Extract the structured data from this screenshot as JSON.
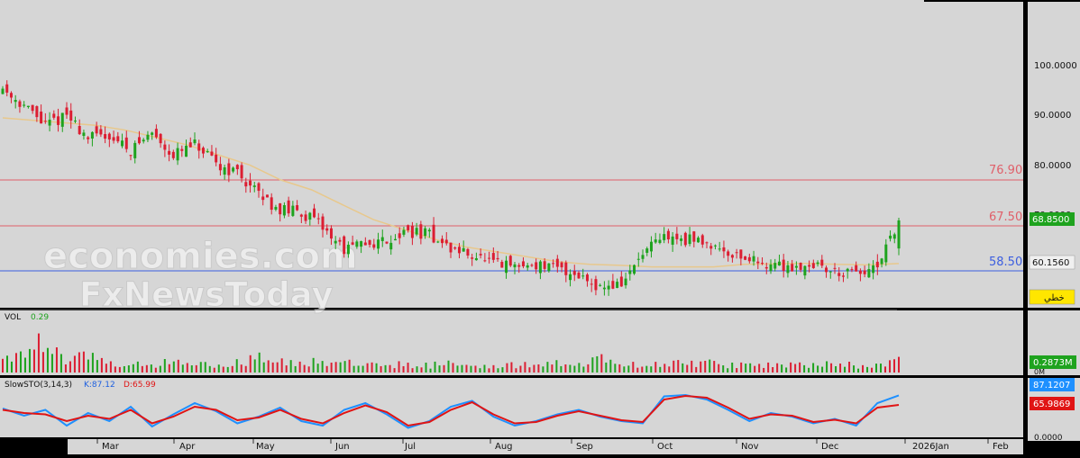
{
  "watermark": {
    "line1": "economies.com",
    "line2": "FxNewsToday"
  },
  "price_axis": {
    "ticks": [
      "100.0000",
      "90.0000",
      "80.0000",
      "70.0000"
    ]
  },
  "levels": [
    {
      "value": 76.9,
      "label": "76.90",
      "color": "#e0606a"
    },
    {
      "value": 67.5,
      "label": "67.50",
      "color": "#e0606a"
    },
    {
      "value": 58.5,
      "label": "58.50",
      "color": "#3c5ee0"
    }
  ],
  "tags": {
    "last_price": "68.8500",
    "ma_value": "60.1560",
    "scale_mode": "خطي",
    "volume_last": "0.2873M",
    "volume_axis_low": "0M",
    "stoch_k_value": "87.1207",
    "stoch_d_value": "65.9869",
    "stoch_axis_low": "0.0000"
  },
  "volume_panel": {
    "label": "VOL",
    "value": "0.29"
  },
  "stoch_panel": {
    "label": "SlowSTO(3,14,3)",
    "k_label": "K:87.12",
    "d_label": "D:65.99"
  },
  "x_axis": {
    "months": [
      "Mar",
      "Apr",
      "May",
      "Jun",
      "Jul",
      "Aug",
      "Sep",
      "Oct",
      "Nov",
      "Dec",
      "2026Jan",
      "Feb"
    ]
  },
  "colors": {
    "up": "#1ea31e",
    "down": "#dc1e32",
    "ma": "#e8c88c",
    "k": "#1e90ff",
    "d": "#e01414",
    "panel_bg": "#d6d6d6"
  },
  "chart_data": {
    "type": "candlestick",
    "y_range": [
      50.8,
      107.6
    ],
    "series": [
      {
        "name": "price_close_weekly",
        "x": [
          "Feb-w1",
          "Feb-w2",
          "Feb-w3",
          "Mar-w1",
          "Mar-w2",
          "Mar-w3",
          "Mar-w4",
          "Apr-w1",
          "Apr-w2",
          "Apr-w3",
          "Apr-w4",
          "May-w1",
          "May-w2",
          "May-w3",
          "May-w4",
          "Jun-w1",
          "Jun-w2",
          "Jun-w3",
          "Jun-w4",
          "Jul-w1",
          "Jul-w2",
          "Jul-w3",
          "Jul-w4",
          "Aug-w1",
          "Aug-w2",
          "Aug-w3",
          "Aug-w4",
          "Sep-w1",
          "Sep-w2",
          "Sep-w3",
          "Sep-w4",
          "Oct-w1",
          "Oct-w2",
          "Oct-w3",
          "Oct-w4",
          "Nov-w1",
          "Nov-w2",
          "Nov-w3",
          "Nov-w4",
          "Dec-w1",
          "Dec-w2",
          "Dec-w3",
          "Dec-w4"
        ],
        "values": [
          95.5,
          92.0,
          88.0,
          90.0,
          85.5,
          86.0,
          83.0,
          86.5,
          82.0,
          84.0,
          80.0,
          78.5,
          74.0,
          71.0,
          70.5,
          67.5,
          63.0,
          64.0,
          65.0,
          66.5,
          66.0,
          63.0,
          62.0,
          60.0,
          59.5,
          60.0,
          59.0,
          58.0,
          55.5,
          56.0,
          62.0,
          65.5,
          65.0,
          64.5,
          62.5,
          61.0,
          60.0,
          59.5,
          60.0,
          58.5,
          58.0,
          59.0,
          68.85
        ]
      },
      {
        "name": "moving_average",
        "values": [
          89.5,
          89.0,
          88.5,
          88.0,
          87.0,
          85.5,
          84.0,
          82.0,
          80.0,
          77.0,
          75.0,
          72.0,
          69.0,
          67.0,
          65.0,
          63.5,
          62.5,
          61.5,
          60.5,
          60.0,
          59.8,
          59.5,
          59.5,
          59.5,
          60.0,
          60.1,
          60.2,
          60.0,
          59.9,
          60.16
        ]
      },
      {
        "name": "volume",
        "values": [
          0.35,
          0.4,
          0.9,
          0.3,
          0.5,
          0.25,
          0.3,
          0.2,
          0.35,
          0.3,
          0.2,
          0.25,
          0.4,
          0.3,
          0.3,
          0.3,
          0.25,
          0.2,
          0.25,
          0.2,
          0.2,
          0.25,
          0.2,
          0.2,
          0.2,
          0.3,
          0.25,
          0.2,
          0.35,
          0.25,
          0.2,
          0.2,
          0.3,
          0.25,
          0.2,
          0.2,
          0.2,
          0.2,
          0.2,
          0.25,
          0.2,
          0.2,
          0.29
        ]
      },
      {
        "name": "stoch_k",
        "values": [
          58,
          42,
          55,
          20,
          48,
          30,
          62,
          18,
          45,
          70,
          52,
          25,
          40,
          60,
          30,
          20,
          55,
          70,
          45,
          15,
          30,
          62,
          75,
          40,
          20,
          30,
          45,
          55,
          40,
          30,
          25,
          85,
          88,
          78,
          55,
          30,
          48,
          40,
          25,
          35,
          20,
          70,
          87.12
        ]
      },
      {
        "name": "stoch_d",
        "values": [
          55,
          48,
          45,
          30,
          42,
          35,
          55,
          25,
          40,
          62,
          55,
          32,
          38,
          55,
          35,
          25,
          48,
          65,
          50,
          20,
          28,
          55,
          72,
          45,
          25,
          28,
          42,
          52,
          42,
          32,
          28,
          78,
          86,
          82,
          60,
          35,
          45,
          42,
          28,
          33,
          25,
          60,
          65.99
        ]
      }
    ]
  }
}
